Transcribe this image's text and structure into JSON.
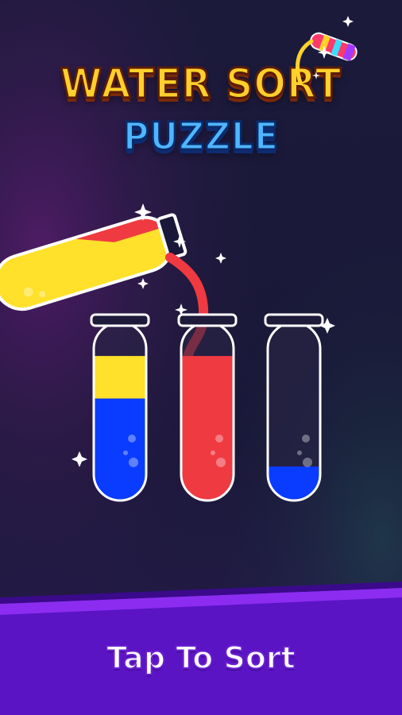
{
  "title": {
    "line1": "WATER SORT",
    "line2": "PUZZLE"
  },
  "tubes": [
    {
      "name": "tube-1",
      "layers": [
        {
          "color": "#ffe02a",
          "fraction": 0.25
        },
        {
          "color": "#0a3cff",
          "fraction": 0.6
        }
      ]
    },
    {
      "name": "tube-2",
      "layers": [
        {
          "color": "#ef3a42",
          "fraction": 0.85
        }
      ]
    },
    {
      "name": "tube-3",
      "layers": [
        {
          "color": "#0a3cff",
          "fraction": 0.2
        }
      ]
    }
  ],
  "pouring_tube": {
    "layers": [
      {
        "color": "#ffe02a"
      },
      {
        "color": "#ef3a42"
      }
    ]
  },
  "footer": {
    "label": "Tap To Sort"
  },
  "colors": {
    "background_top": "#1a1a3c",
    "background_bottom": "#241a4a",
    "accent_purple": "#5e16c8",
    "banner_purple": "#7a2ae0"
  }
}
